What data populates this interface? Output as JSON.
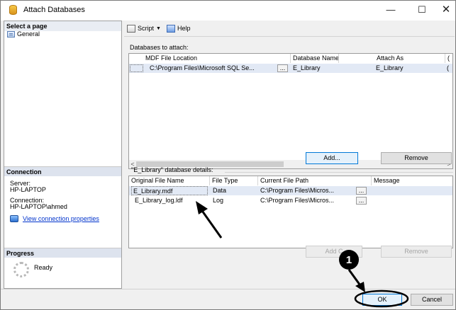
{
  "window": {
    "title": "Attach Databases",
    "min_glyph": "—",
    "max_glyph": "☐",
    "close_glyph": "✕"
  },
  "sidebar": {
    "select_page_header": "Select a page",
    "general_label": "General",
    "connection_header": "Connection",
    "server_label": "Server:",
    "server_value": "HP-LAPTOP",
    "connection_label": "Connection:",
    "connection_value": "HP-LAPTOP\\ahmed",
    "view_props_link": "View connection properties",
    "progress_header": "Progress",
    "progress_status": "Ready"
  },
  "toolbar": {
    "script_label": "Script",
    "caret": "▼",
    "help_label": "Help"
  },
  "databases": {
    "label": "Databases to attach:",
    "columns": [
      "MDF File Location",
      "Database Name",
      "Attach As",
      "("
    ],
    "rows": [
      {
        "location": "C:\\Program Files\\Microsoft SQL Se...",
        "ellipsis": "...",
        "database_name": "E_Library",
        "attach_as": "E_Library",
        "overflow": "("
      }
    ],
    "scroll_left": "<",
    "scroll_right": ">",
    "add_button": "Add...",
    "remove_button": "Remove"
  },
  "details": {
    "label": "\"E_Library\" database details:",
    "columns": [
      "Original File Name",
      "File Type",
      "Current File Path",
      "Message"
    ],
    "rows": [
      {
        "name": "E_Library.mdf",
        "type": "Data",
        "path": "C:\\Program Files\\Micros...",
        "ellipsis": "..."
      },
      {
        "name": "E_Library_log.ldf",
        "type": "Log",
        "path": "C:\\Program Files\\Micros...",
        "ellipsis": "..."
      }
    ],
    "add_catalog_button": "Add C",
    "remove_button": "Remove"
  },
  "footer": {
    "ok_button": "OK",
    "cancel_button": "Cancel"
  },
  "annotation": {
    "step_number": "1"
  },
  "colors": {
    "accent": "#0078d7",
    "link": "#0033cc",
    "selected_row": "#e2e9f5",
    "section_header": "#dde3ee"
  }
}
